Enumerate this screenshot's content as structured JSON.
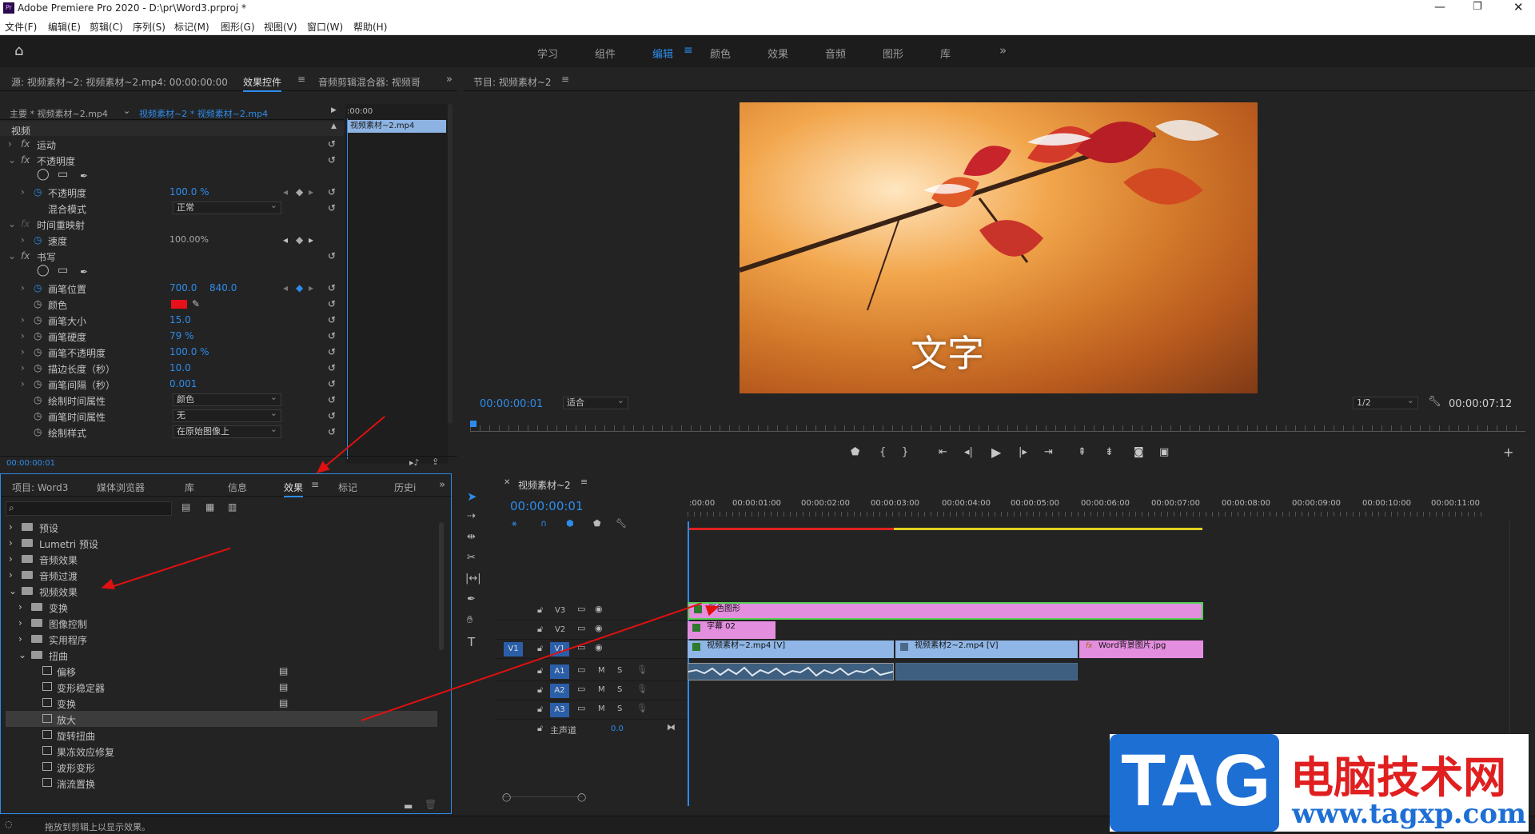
{
  "app": {
    "title": "Adobe Premiere Pro 2020 - D:\\pr\\Word3.prproj *",
    "icon_label": "Pr",
    "menu": [
      "文件(F)",
      "编辑(E)",
      "剪辑(C)",
      "序列(S)",
      "标记(M)",
      "图形(G)",
      "视图(V)",
      "窗口(W)",
      "帮助(H)"
    ]
  },
  "workspaces": {
    "tabs": [
      "学习",
      "组件",
      "编辑",
      "颜色",
      "效果",
      "音频",
      "图形",
      "库"
    ],
    "active": "编辑",
    "more": "»"
  },
  "effect_controls": {
    "tabs": [
      "源: 视频素材~2: 视频素材~2.mp4: 00:00:00:00",
      "效果控件",
      "音频剪辑混合器: 视频哥"
    ],
    "master_label": "主要 * 视频素材~2.mp4",
    "clip_label": "视频素材~2 * 视频素材~2.mp4",
    "ruler_time": ":00:00",
    "clip_block": "视频素材~2.mp4",
    "section": "视频",
    "rows": [
      {
        "name": "运动"
      },
      {
        "name": "不透明度"
      },
      {
        "name": "不透明度",
        "value": "100.0 %"
      },
      {
        "name": "混合模式",
        "value": "正常"
      },
      {
        "name": "时间重映射"
      },
      {
        "name": "速度",
        "value": "100.00%"
      },
      {
        "name": "书写"
      },
      {
        "name": "画笔位置",
        "value": "700.0",
        "value2": "840.0"
      },
      {
        "name": "颜色"
      },
      {
        "name": "画笔大小",
        "value": "15.0"
      },
      {
        "name": "画笔硬度",
        "value": "79 %"
      },
      {
        "name": "画笔不透明度",
        "value": "100.0 %"
      },
      {
        "name": "描边长度（秒）",
        "value": "10.0"
      },
      {
        "name": "画笔间隔（秒）",
        "value": "0.001"
      },
      {
        "name": "绘制时间属性",
        "value": "颜色"
      },
      {
        "name": "画笔时间属性",
        "value": "无"
      },
      {
        "name": "绘制样式",
        "value": "在原始图像上"
      }
    ],
    "color_swatch": "#e8101a",
    "timecode": "00:00:00:01"
  },
  "program": {
    "title": "节目: 视频素材~2",
    "overlay_text": "文字",
    "timecode": "00:00:00:01",
    "fit": "适合",
    "quality": "1/2",
    "duration": "00:00:07:12"
  },
  "project": {
    "tabs": [
      "项目: Word3",
      "媒体浏览器",
      "库",
      "信息",
      "效果",
      "标记",
      "历史i"
    ],
    "active": "效果",
    "search_placeholder": "",
    "tree": [
      {
        "name": "预设",
        "level": 0,
        "type": "folder"
      },
      {
        "name": "Lumetri 预设",
        "level": 0,
        "type": "folder"
      },
      {
        "name": "音频效果",
        "level": 0,
        "type": "folder"
      },
      {
        "name": "音频过渡",
        "level": 0,
        "type": "folder"
      },
      {
        "name": "视频效果",
        "level": 0,
        "type": "folder",
        "open": true
      },
      {
        "name": "变换",
        "level": 1,
        "type": "folder"
      },
      {
        "name": "图像控制",
        "level": 1,
        "type": "folder"
      },
      {
        "name": "实用程序",
        "level": 1,
        "type": "folder"
      },
      {
        "name": "扭曲",
        "level": 1,
        "type": "folder",
        "open": true
      },
      {
        "name": "偏移",
        "level": 2,
        "type": "fx",
        "badge": true
      },
      {
        "name": "变形稳定器",
        "level": 2,
        "type": "fx",
        "badge": true
      },
      {
        "name": "变换",
        "level": 2,
        "type": "fx",
        "badge": true
      },
      {
        "name": "放大",
        "level": 2,
        "type": "fx",
        "selected": true
      },
      {
        "name": "旋转扭曲",
        "level": 2,
        "type": "fx"
      },
      {
        "name": "果冻效应修复",
        "level": 2,
        "type": "fx"
      },
      {
        "name": "波形变形",
        "level": 2,
        "type": "fx"
      },
      {
        "name": "湍流置换",
        "level": 2,
        "type": "fx"
      }
    ]
  },
  "timeline": {
    "title": "视频素材~2",
    "timecode": "00:00:00:01",
    "ruler": [
      ":00:00",
      "00:00:01:00",
      "00:00:02:00",
      "00:00:03:00",
      "00:00:04:00",
      "00:00:05:00",
      "00:00:06:00",
      "00:00:07:00",
      "00:00:08:00",
      "00:00:09:00",
      "00:00:10:00",
      "00:00:11:00"
    ],
    "tracks": [
      {
        "label": "V3",
        "m": "",
        "s": ""
      },
      {
        "label": "V2",
        "m": "",
        "s": ""
      },
      {
        "label": "V1",
        "m": "",
        "s": "",
        "source": "V1"
      },
      {
        "label": "A1",
        "m": "M",
        "s": "S"
      },
      {
        "label": "A2",
        "m": "M",
        "s": "S"
      },
      {
        "label": "A3",
        "m": "M",
        "s": "S"
      }
    ],
    "master": {
      "label": "主声道",
      "value": "0.0"
    },
    "clips": {
      "v3": "彩色图形",
      "v2": "字幕 02",
      "v1a": "视频素材~2.mp4 [V]",
      "v1b": "视频素材2~2.mp4 [V]",
      "v1c": "Word背景图片.jpg",
      "v1c_badge": "fx"
    }
  },
  "status_bar": "拖放到剪辑上以显示效果。",
  "watermark": {
    "tag": "TAG",
    "cn": "电脑技术网",
    "url": "www.tagxp.com"
  }
}
